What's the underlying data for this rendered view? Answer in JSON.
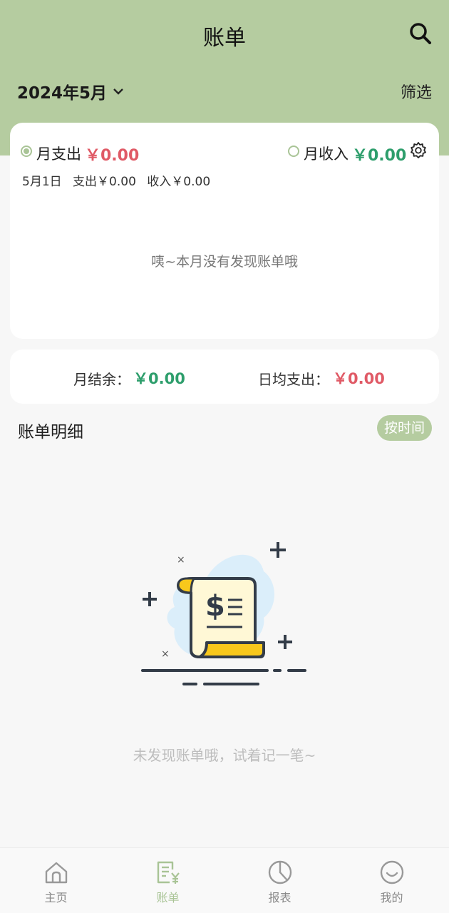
{
  "header": {
    "title": "账单",
    "month": "2024年5月",
    "filter_label": "筛选"
  },
  "summary": {
    "expense_label": "月支出",
    "expense_value": "￥0.00",
    "income_label": "月收入",
    "income_value": "￥0.00",
    "selected": "expense",
    "day_date": "5月1日",
    "day_expense": "支出￥0.00",
    "day_income": "收入￥0.00",
    "empty_text": "咦~本月没有发现账单哦"
  },
  "balance": {
    "remain_label": "月结余：",
    "remain_value": "￥0.00",
    "avg_label": "日均支出：",
    "avg_value": "￥0.00"
  },
  "detail": {
    "title": "账单明细",
    "sort_label": "按时间",
    "empty_text": "未发现账单哦，试着记一笔~"
  },
  "tabs": [
    {
      "label": "主页",
      "icon": "home-icon",
      "active": false
    },
    {
      "label": "账单",
      "icon": "bill-icon",
      "active": true
    },
    {
      "label": "报表",
      "icon": "chart-icon",
      "active": false
    },
    {
      "label": "我的",
      "icon": "profile-icon",
      "active": false
    }
  ],
  "colors": {
    "header": "#b5cca0",
    "accent": "#a9c496",
    "expense": "#e05a66",
    "income": "#2e9e6c"
  }
}
